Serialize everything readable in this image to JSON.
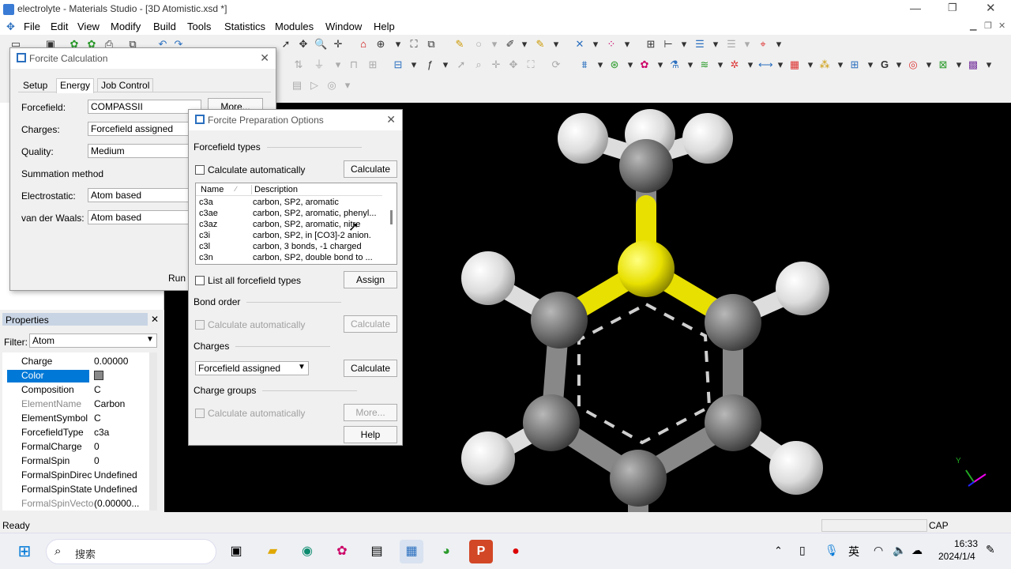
{
  "window": {
    "title": "electrolyte - Materials Studio - [3D Atomistic.xsd *]"
  },
  "menu": [
    "File",
    "Edit",
    "View",
    "Modify",
    "Build",
    "Tools",
    "Statistics",
    "Modules",
    "Window",
    "Help"
  ],
  "forcite_calc": {
    "title": "Forcite Calculation",
    "tabs": [
      "Setup",
      "Energy",
      "Job Control"
    ],
    "forcefield_label": "Forcefield:",
    "forcefield_value": "COMPASSII",
    "more_label": "More...",
    "charges_label": "Charges:",
    "charges_value": "Forcefield assigned",
    "quality_label": "Quality:",
    "quality_value": "Medium",
    "summation_label": "Summation method",
    "electrostatic_label": "Electrostatic:",
    "electrostatic_value": "Atom based",
    "vdw_label": "van der Waals:",
    "vdw_value": "Atom based",
    "run_label": "Run"
  },
  "prep": {
    "title": "Forcite Preparation Options",
    "ff_types_label": "Forcefield types",
    "calc_auto_label": "Calculate automatically",
    "calculate_label": "Calculate",
    "col_name": "Name",
    "col_desc": "Description",
    "rows": [
      {
        "name": "c3a",
        "desc": "carbon, SP2, aromatic"
      },
      {
        "name": "c3ae",
        "desc": "carbon, SP2, aromatic, phenyl..."
      },
      {
        "name": "c3az",
        "desc": "carbon, SP2, aromatic, nitre"
      },
      {
        "name": "c3i",
        "desc": "carbon, SP2, in [CO3]-2 anion."
      },
      {
        "name": "c3l",
        "desc": "carbon, 3 bonds, -1 charged"
      },
      {
        "name": "c3n",
        "desc": "carbon, SP2, double bond to ..."
      }
    ],
    "list_all_label": "List all forcefield types",
    "assign_label": "Assign",
    "bond_order_label": "Bond order",
    "charges_label": "Charges",
    "charges_value": "Forcefield assigned",
    "charge_groups_label": "Charge groups",
    "more_label": "More...",
    "help_label": "Help"
  },
  "properties": {
    "title": "Properties",
    "filter_label": "Filter:",
    "filter_value": "Atom",
    "rows": [
      {
        "k": "Charge",
        "v": "0.00000"
      },
      {
        "k": "Color",
        "v": ""
      },
      {
        "k": "Composition",
        "v": "C"
      },
      {
        "k": "ElementName",
        "v": "Carbon"
      },
      {
        "k": "ElementSymbol",
        "v": "C"
      },
      {
        "k": "ForcefieldType",
        "v": "c3a"
      },
      {
        "k": "FormalCharge",
        "v": "0"
      },
      {
        "k": "FormalSpin",
        "v": "0"
      },
      {
        "k": "FormalSpinDirec",
        "v": "Undefined"
      },
      {
        "k": "FormalSpinState",
        "v": "Undefined"
      },
      {
        "k": "FormalSpinVecto",
        "v": "(0.00000..."
      }
    ]
  },
  "status": {
    "ready": "Ready",
    "cap": "CAP"
  },
  "taskbar": {
    "search_placeholder": "搜索",
    "ime": "英",
    "time": "16:33",
    "date": "2024/1/4"
  },
  "axes": {
    "y": "Y"
  },
  "colors": {
    "accent": "#0078d7",
    "selected_row": "#0078d7",
    "sulfur": "#e8e000",
    "carbon": "#808080",
    "hydrogen": "#e8e8e8"
  }
}
